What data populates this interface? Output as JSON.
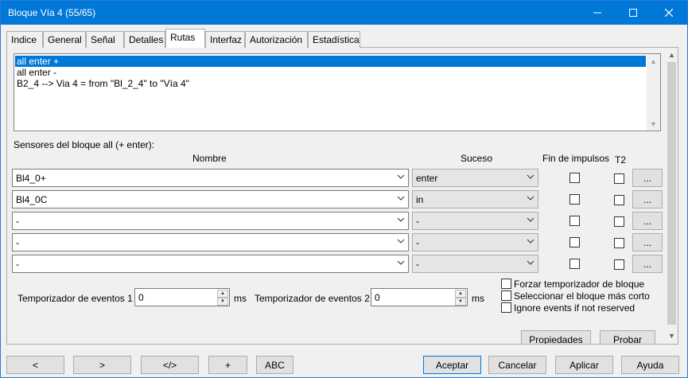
{
  "window": {
    "title": "Bloque Vía 4 (55/65)"
  },
  "tabs": [
    "Indice",
    "General",
    "Señal",
    "Detalles",
    "Rutas",
    "Interfaz",
    "Autorización",
    "Estadística"
  ],
  "routes": [
    "all enter +",
    "all enter -",
    "B2_4 --> Via 4 = from \"Bl_2_4\" to \"Vía 4\""
  ],
  "sensors": {
    "heading": "Sensores del bloque all (+ enter):",
    "col_nombre": "Nombre",
    "col_suceso": "Suceso",
    "col_fin": "Fin de impulsos",
    "col_t2": "T2",
    "rows": [
      {
        "nombre": "Bl4_0+",
        "suceso": "enter",
        "dots": "..."
      },
      {
        "nombre": "Bl4_0C",
        "suceso": "in",
        "dots": "..."
      },
      {
        "nombre": "-",
        "suceso": "-",
        "dots": "..."
      },
      {
        "nombre": "-",
        "suceso": "-",
        "dots": "..."
      },
      {
        "nombre": "-",
        "suceso": "-",
        "dots": "..."
      }
    ]
  },
  "timers": {
    "t1_label": "Temporizador de eventos 1",
    "t1_value": "0",
    "t2_label": "Temporizador de eventos 2",
    "t2_value": "0",
    "unit": "ms"
  },
  "options": {
    "forzar": "Forzar temporizador de bloque",
    "seleccionar": "Seleccionar el bloque más corto",
    "ignore": "Ignore events if not reserved"
  },
  "panel_buttons": {
    "propiedades": "Propiedades",
    "probar": "Probar"
  },
  "bottom": {
    "prev": "<",
    "next": ">",
    "code": "</>",
    "plus": "+",
    "abc": "ABC",
    "aceptar": "Aceptar",
    "cancelar": "Cancelar",
    "aplicar": "Aplicar",
    "ayuda": "Ayuda"
  }
}
